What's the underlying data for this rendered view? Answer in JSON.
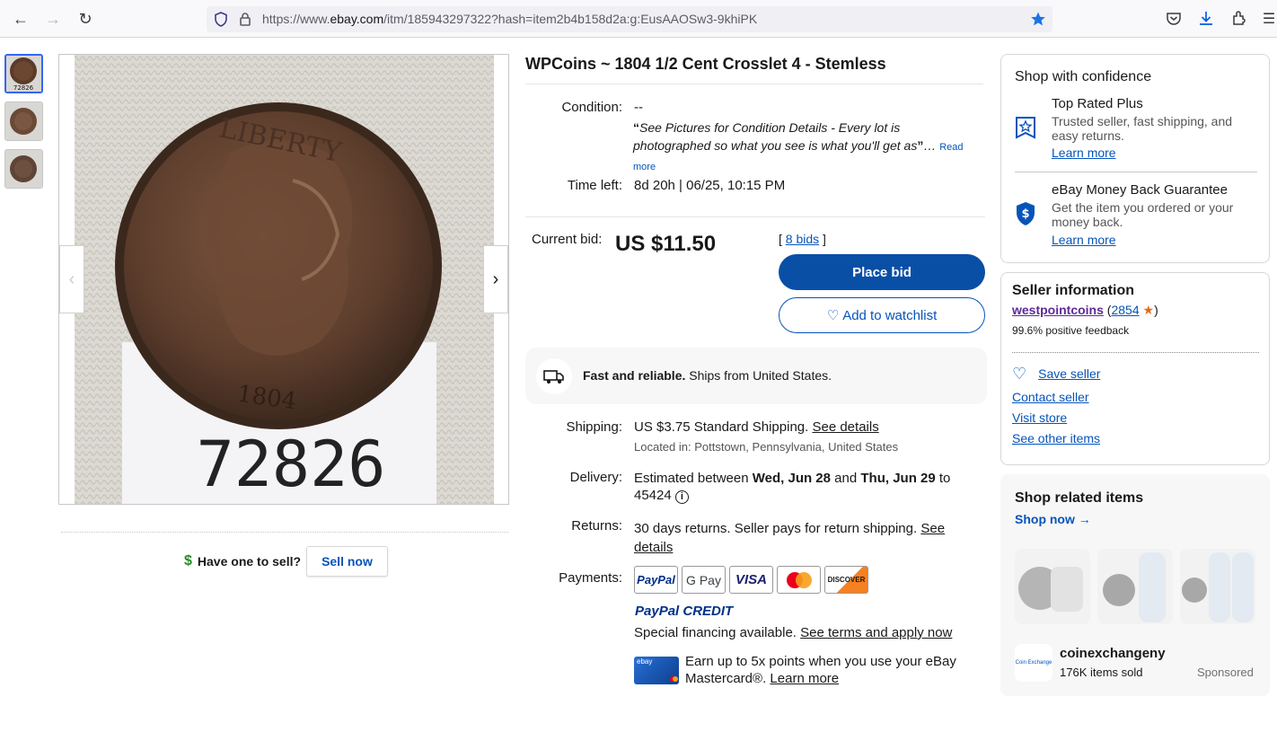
{
  "browser": {
    "url_prefix": "https://www.",
    "url_domain": "ebay.com",
    "url_rest": "/itm/185943297322?hash=item2b4b158d2a:g:EusAAOSw3-9khiPK"
  },
  "gallery": {
    "thumb_label": "72826",
    "image_number": "72826",
    "coin_legend": "LIBERTY",
    "coin_year": "1804"
  },
  "sell": {
    "question": "Have one to sell?",
    "button": "Sell now"
  },
  "item": {
    "title": "WPCoins ~ 1804 1/2 Cent Crosslet 4 - Stemless",
    "condition_label": "Condition:",
    "condition_value": "--",
    "condition_note": "See Pictures for Condition Details - Every lot is photographed so what you see is what you'll get as",
    "read_more": "Read more",
    "time_left_label": "Time left:",
    "time_left_value": "8d 20h | 06/25, 10:15 PM",
    "current_bid_label": "Current bid:",
    "price": "US $11.50",
    "bids_link": "8 bids",
    "place_bid": "Place bid",
    "watchlist": "Add to watchlist"
  },
  "ship_banner": {
    "bold": "Fast and reliable.",
    "rest": "Ships from United States."
  },
  "shipping": {
    "label": "Shipping:",
    "value": "US $3.75 Standard Shipping.",
    "see_details": "See details",
    "location": "Located in: Pottstown, Pennsylvania, United States"
  },
  "delivery": {
    "label": "Delivery:",
    "prefix": "Estimated between",
    "date1": "Wed, Jun 28",
    "and": "and",
    "date2": "Thu, Jun 29",
    "to": "to",
    "zip": "45424"
  },
  "returns": {
    "label": "Returns:",
    "value": "30 days returns. Seller pays for return shipping.",
    "see": "See",
    "details": "details"
  },
  "payments": {
    "label": "Payments:",
    "methods": [
      "PayPal",
      "G Pay",
      "VISA",
      "Mastercard",
      "DISCOVER"
    ],
    "paypal_credit_a": "PayPal",
    "paypal_credit_b": "CREDIT",
    "financing": "Special financing available.",
    "terms_link": "See terms and apply now",
    "card_brand": "ebay",
    "mastercard_text": "Earn up to 5x points when you use your eBay Mastercard®.",
    "learn_more": "Learn more"
  },
  "confidence": {
    "title": "Shop with confidence",
    "trp_title": "Top Rated Plus",
    "trp_desc": "Trusted seller, fast shipping, and easy returns.",
    "trp_link": "Learn more",
    "mbg_title": "eBay Money Back Guarantee",
    "mbg_desc": "Get the item you ordered or your money back.",
    "mbg_link": "Learn more"
  },
  "seller": {
    "title": "Seller information",
    "name": "westpointcoins",
    "score": "2854",
    "feedback": "99.6% positive feedback",
    "save": "Save seller",
    "contact": "Contact seller",
    "store": "Visit store",
    "other": "See other items"
  },
  "related": {
    "title": "Shop related items",
    "shop_now": "Shop now",
    "store_logo_text": "Coin Exchange",
    "store_name": "coinexchangeny",
    "items_sold": "176K items sold",
    "sponsored": "Sponsored"
  },
  "colors": {
    "accent_blue": "#0654ba",
    "button_blue": "#0a4fa6",
    "star_blue": "#1a73e8"
  }
}
